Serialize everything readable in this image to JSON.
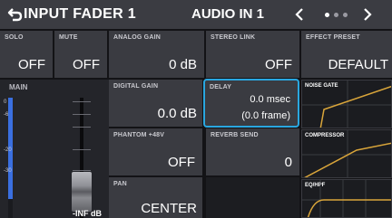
{
  "header": {
    "title": "INPUT FADER 1",
    "channel": "AUDIO IN 1",
    "pager_total": 3,
    "pager_active": 0
  },
  "row1": {
    "solo": {
      "label": "SOLO",
      "value": "OFF"
    },
    "mute": {
      "label": "MUTE",
      "value": "OFF"
    },
    "analog_gain": {
      "label": "ANALOG GAIN",
      "value": "0 dB"
    },
    "stereo_link": {
      "label": "STEREO LINK",
      "value": "OFF"
    },
    "effect_preset": {
      "label": "EFFECT PRESET",
      "value": "DEFAULT"
    }
  },
  "fader": {
    "label": "MAIN",
    "value": "-INF dB",
    "scale": [
      "0",
      "-6",
      "-20",
      "-30"
    ]
  },
  "params": {
    "digital_gain": {
      "label": "DIGITAL GAIN",
      "value": "0.0 dB"
    },
    "delay": {
      "label": "DELAY",
      "value_msec": "0.0 msec",
      "value_frame": "(0.0 frame)"
    },
    "phantom": {
      "label": "PHANTOM +48V",
      "value": "OFF"
    },
    "reverb_send": {
      "label": "REVERB SEND",
      "value": "0"
    },
    "pan": {
      "label": "PAN",
      "value": "CENTER"
    }
  },
  "graphs": {
    "noise_gate": "NOISE GATE",
    "compressor": "COMPRESSOR",
    "eq": "EQ/HPF"
  },
  "colors": {
    "accent": "#2aa7e0",
    "meter": "#3a6fe0",
    "curve": "#d9a53a"
  }
}
